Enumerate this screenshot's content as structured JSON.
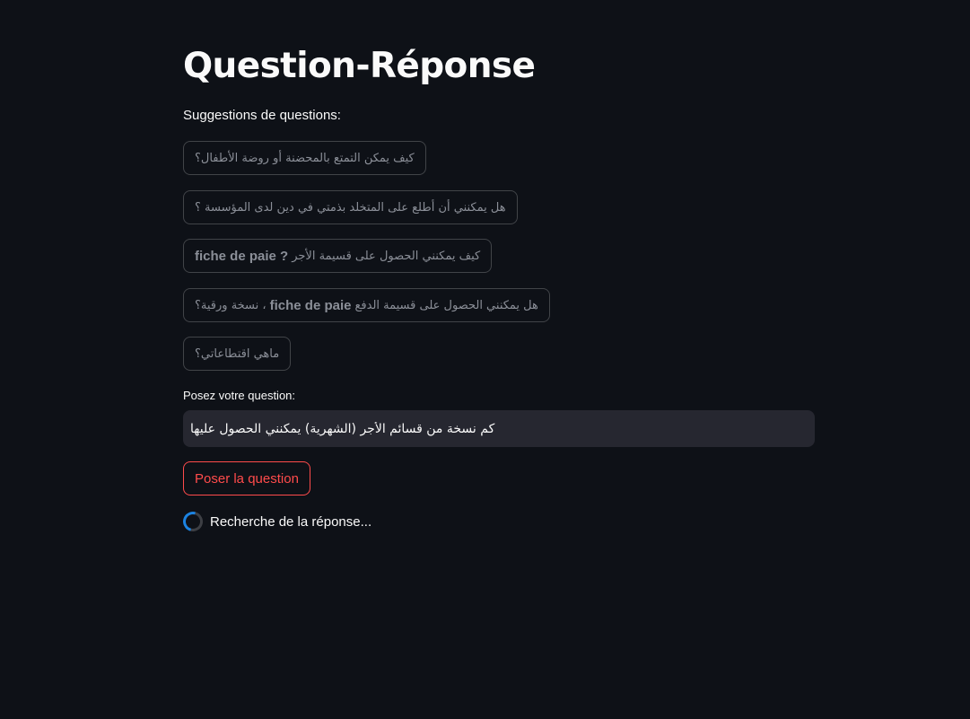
{
  "page": {
    "title": "Question-Réponse",
    "suggestions_label": "Suggestions de questions:"
  },
  "suggestions": [
    {
      "text": "كيف يمكن التمتع بالمحضنة أو روضة الأطفال؟"
    },
    {
      "text": "هل يمكنني أن أطلع على المتخلد بذمتي في دين لدى المؤسسة ؟"
    },
    {
      "text_ar": "كيف يمكنني الحصول على قسيمة الأجر",
      "text_fr": "fiche de paie ?"
    },
    {
      "text_ar_1": "هل يمكنني الحصول على قسيمة الدفع",
      "text_fr": "fiche de paie",
      "text_ar_2": "، نسخة ورقية؟"
    },
    {
      "text": "ماهي اقتطاعاتي؟"
    }
  ],
  "question": {
    "label": "Posez votre question:",
    "value": "كم نسخة من قسائم الأجر (الشهرية) يمكنني الحصول عليها"
  },
  "ask_button": {
    "label": "Poser la question"
  },
  "status": {
    "text": "Recherche de la réponse..."
  },
  "colors": {
    "background": "#0e1117",
    "input_background": "#262730",
    "accent": "#ff4b4b",
    "spinner": "#1c83e1"
  }
}
